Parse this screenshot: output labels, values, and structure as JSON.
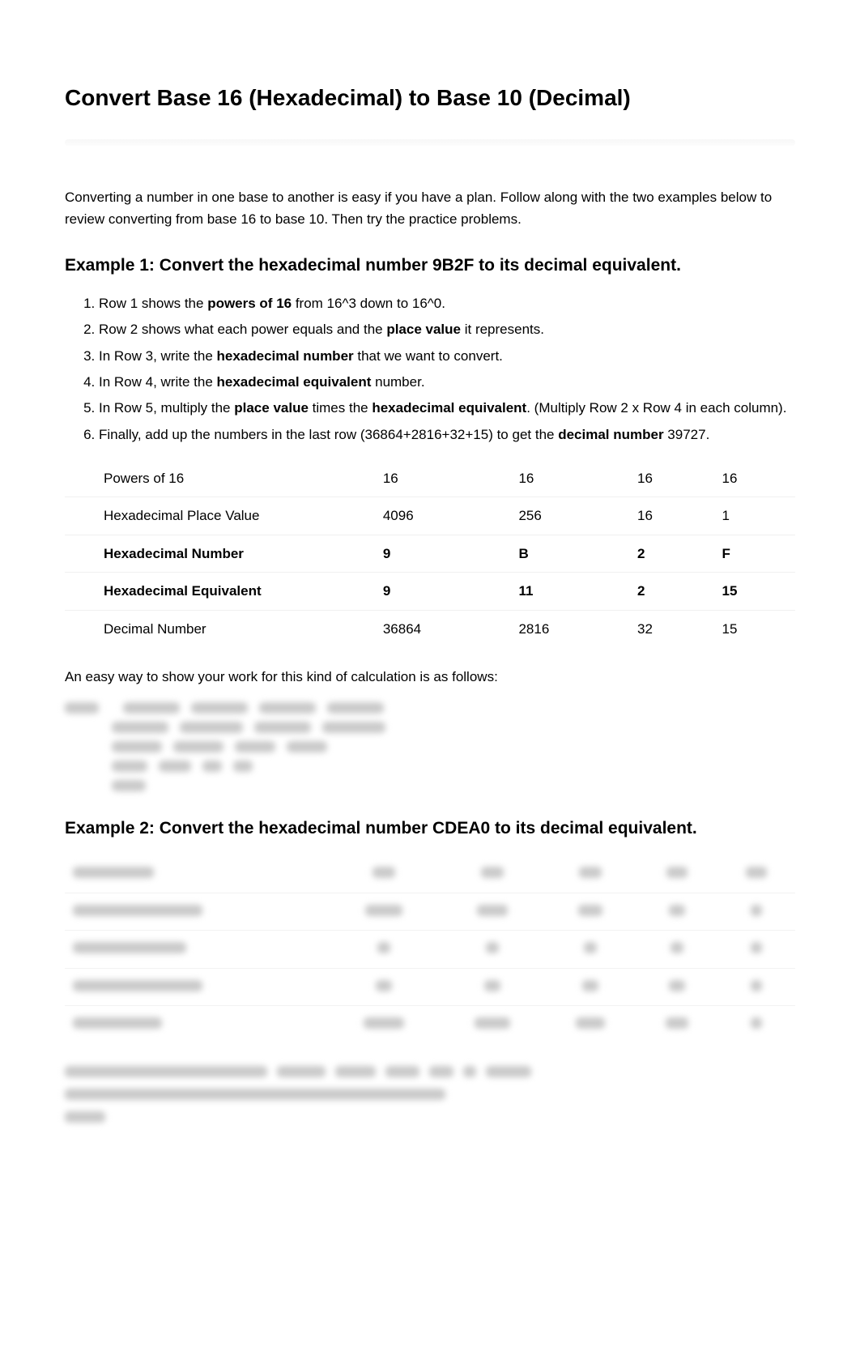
{
  "title": "Convert Base 16 (Hexadecimal) to Base 10 (Decimal)",
  "intro": "Converting a number in one base to another is easy if you have a plan. Follow along with the two examples below to review converting from base 16 to base 10. Then try the practice problems.",
  "example1": {
    "heading": "Example 1: Convert the hexadecimal number 9B2F to its decimal equivalent.",
    "steps": {
      "s1_pre": "Row 1 shows the ",
      "s1_b": "powers of 16",
      "s1_post": " from 16^3 down to 16^0.",
      "s2_pre": "Row 2 shows what each power equals and the ",
      "s2_b": "place value",
      "s2_post": " it represents.",
      "s3_pre": "In Row 3, write the ",
      "s3_b": "hexadecimal number",
      "s3_post": " that we want to convert.",
      "s4_pre": "In Row 4, write the ",
      "s4_b": "hexadecimal equivalent",
      "s4_post": " number.",
      "s5_pre": "In Row 5, multiply the ",
      "s5_b1": "place value",
      "s5_mid": " times the ",
      "s5_b2": "hexadecimal equivalent",
      "s5_post": ". (Multiply Row 2 x Row 4 in each column).",
      "s6_pre": "Finally, add up the numbers in the last row (36864+2816+32+15) to get the ",
      "s6_b": "decimal number",
      "s6_post": " 39727."
    },
    "table": {
      "r1": {
        "label": "Powers of 16",
        "c1": "16",
        "c2": "16",
        "c3": "16",
        "c4": "16"
      },
      "r2": {
        "label": "Hexadecimal Place Value",
        "c1": "4096",
        "c2": "256",
        "c3": "16",
        "c4": "1"
      },
      "r3": {
        "label": "Hexadecimal Number",
        "c1": "9",
        "c2": "B",
        "c3": "2",
        "c4": "F"
      },
      "r4": {
        "label": "Hexadecimal Equivalent",
        "c1": "9",
        "c2": "11",
        "c3": "2",
        "c4": "15"
      },
      "r5": {
        "label": "Decimal Number",
        "c1": "36864",
        "c2": "2816",
        "c3": "32",
        "c4": "15"
      }
    },
    "caption": "An easy way to show your work for this kind of calculation is as follows:"
  },
  "example2": {
    "heading": "Example 2: Convert the hexadecimal number CDEA0 to its decimal equivalent."
  }
}
